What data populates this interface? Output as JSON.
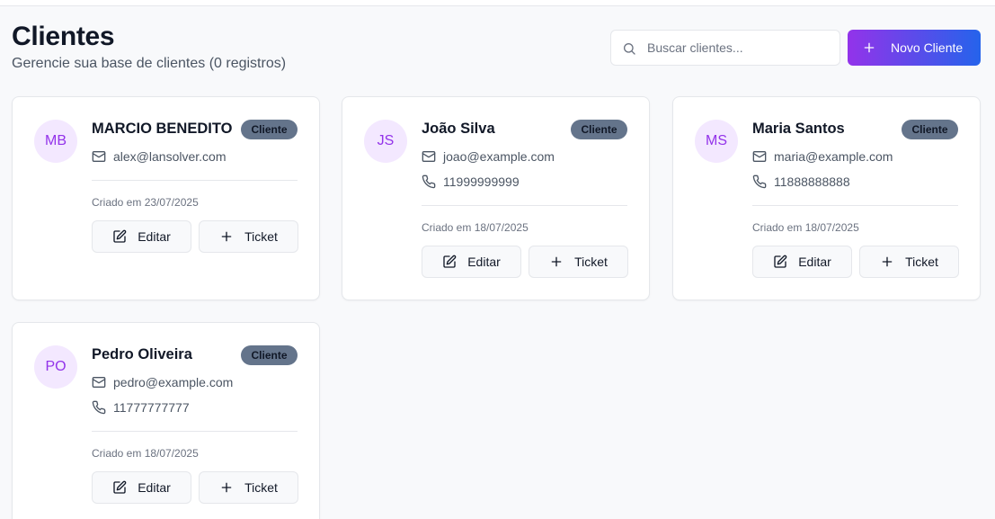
{
  "header": {
    "title": "Clientes",
    "subtitle": "Gerencie sua base de clientes (0 registros)"
  },
  "search": {
    "placeholder": "Buscar clientes...",
    "value": ""
  },
  "actions": {
    "new_client_label": "Novo Cliente"
  },
  "colors": {
    "accent_start": "#9333ea",
    "accent_end": "#2563eb",
    "avatar_bg": "#f3e8ff",
    "avatar_text": "#9333ea",
    "badge_bg": "#64748b"
  },
  "clients": [
    {
      "initials": "MB",
      "name": "MARCIO BENEDITO",
      "badge": "Cliente",
      "email": "alex@lansolver.com",
      "phone": "",
      "created": "Criado em 23/07/2025",
      "edit_label": "Editar",
      "ticket_label": "Ticket"
    },
    {
      "initials": "JS",
      "name": "João Silva",
      "badge": "Cliente",
      "email": "joao@example.com",
      "phone": "11999999999",
      "created": "Criado em 18/07/2025",
      "edit_label": "Editar",
      "ticket_label": "Ticket"
    },
    {
      "initials": "MS",
      "name": "Maria Santos",
      "badge": "Cliente",
      "email": "maria@example.com",
      "phone": "11888888888",
      "created": "Criado em 18/07/2025",
      "edit_label": "Editar",
      "ticket_label": "Ticket"
    },
    {
      "initials": "PO",
      "name": "Pedro Oliveira",
      "badge": "Cliente",
      "email": "pedro@example.com",
      "phone": "11777777777",
      "created": "Criado em 18/07/2025",
      "edit_label": "Editar",
      "ticket_label": "Ticket"
    }
  ]
}
